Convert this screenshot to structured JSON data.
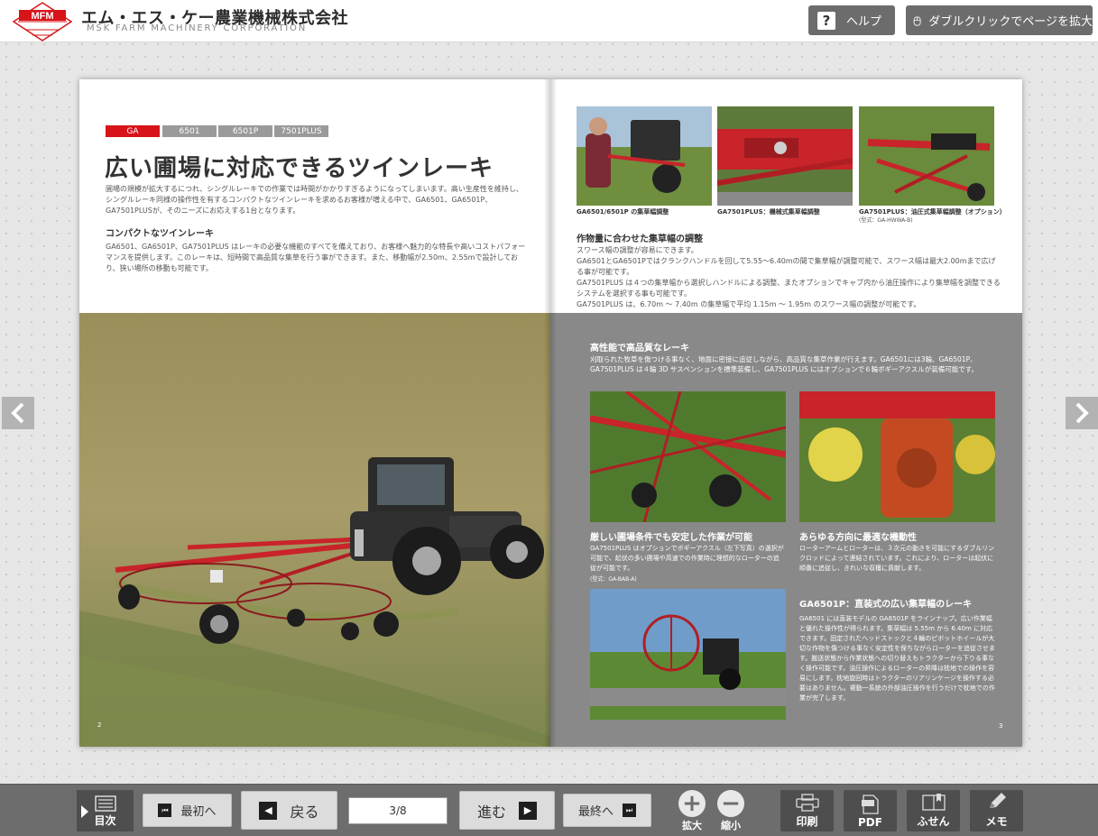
{
  "header": {
    "logo_text": "MFM",
    "company_name_jp": "エム・エス・ケー農業機械株式会社",
    "company_name_en": "MSK FARM MACHINERY CORPORATION",
    "help_label": "ヘルプ",
    "help_icon_text": "?",
    "zoom_hint_label": "ダブルクリックでページを拡大"
  },
  "colors": {
    "brand_red": "#d7141a",
    "panel_gray": "#898989",
    "toolbar_gray": "#6d6d6d"
  },
  "left_page": {
    "tags": [
      "GA",
      "6501",
      "6501P",
      "7501PLUS"
    ],
    "headline": "広い圃場に対応できるツインレーキ",
    "intro": "圃場の規模が拡大するにつれ、シングルレーキでの作業では時間がかかりすぎるようになってしまいます。高い生産性を維持し、シングルレーキ同様の操作性を有するコンパクトなツインレーキを求めるお客様が増える中で、GA6501、GA6501P、GA7501PLUSが、そのニーズにお応えする1台となります。",
    "compact_title": "コンパクトなツインレーキ",
    "compact_text": "GA6501、GA6501P、GA7501PLUS はレーキの必要な機能のすべてを備えており、お客様へ魅力的な特長や高いコストパフォーマンスを提供します。このレーキは、短時間で高品質な集草を行う事ができます。また、移動幅が2.50m、2.55mで設計しており、狭い場所の移動も可能です。",
    "page_number": "2"
  },
  "right_page": {
    "captions": [
      "GA6501/6501P の集草幅調整",
      "GA7501PLUS：機械式集草幅調整",
      "GA7501PLUS：油圧式集草幅調整（オプション）"
    ],
    "caption3_note": "(型式：GA-HWWA-B)",
    "adjust_title": "作物量に合わせた集草幅の調整",
    "adjust_text": "スワース幅の調整が容易にできます。\nGA6501とGA6501Pではクランクハンドルを回して5.55～6.40mの間で集草幅が調整可能で、スワース幅は最大2.00mまで広げる事が可能です。\nGA7501PLUS は４つの集草幅から選択しハンドルによる調整、またオプションでキャブ内から油圧操作により集草幅を調整できるシステムを選択する事も可能です。\nGA7501PLUS は、6.70m ～ 7.40m の集草幅で平均 1.15m ～ 1.95m のスワース幅の調整が可能です。",
    "hq_title": "高性能で高品質なレーキ",
    "hq_text": "刈取られた牧草を傷つける事なく、地面に密接に追従しながら、高品質な集草作業が行えます。GA6501には3輪、GA6501P、GA7501PLUS は４輪 3D サスペンションを標準装備し、GA7501PLUS にはオプションで６輪ボギーアクスルが装備可能です。",
    "stable_title": "厳しい圃場条件でも安定した作業が可能",
    "stable_text": "GA7501PLUS はオプションでボギーアクスル（左下写真）の選択が可能で、起伏の多い圃場や高速での作業時に理想的なローターの追従が可能です。",
    "stable_note": "(型式：GA-BAB-A)",
    "mobility_title": "あらゆる方向に最適な機動性",
    "mobility_text": "ローターアームとローターは、３次元の動きを可能にするダブルリンクロッドによって連結されています。これにより、ローターは起伏に順番に追従し、きれいな収穫に貢献します。",
    "ga6501p_title": "GA6501P：直装式の広い集草幅のレーキ",
    "ga6501p_text": "GA6501 には直装モデルの GA6501P をラインナップ。広い作業幅と優れた操作性が得られます。集草幅は 5.55m から 6.40m に対応できます。固定されたヘッドストックと４輪のピボットホイールが大切な作物を傷つける事なく安定性を保ちながらローターを追従させます。搬送状態から作業状態への切り替えもトラクターから下りる事なく操作可能です。油圧操作によるローターの昇降は枕地での操作を容易にします。枕地旋回時はトラクターのリアリンケージを操作する必要はありません。複動一系統の外部油圧操作を行うだけで枕地での作業が完了します。",
    "page_number": "3"
  },
  "toolbar": {
    "toc_label": "目次",
    "first_label": "最初へ",
    "back_label": "戻る",
    "page_value": "3/8",
    "next_label": "進む",
    "last_label": "最終へ",
    "zoom_in_label": "拡大",
    "zoom_out_label": "縮小",
    "print_label": "印刷",
    "pdf_label": "PDF",
    "sticky_label": "ふせん",
    "memo_label": "メモ"
  }
}
